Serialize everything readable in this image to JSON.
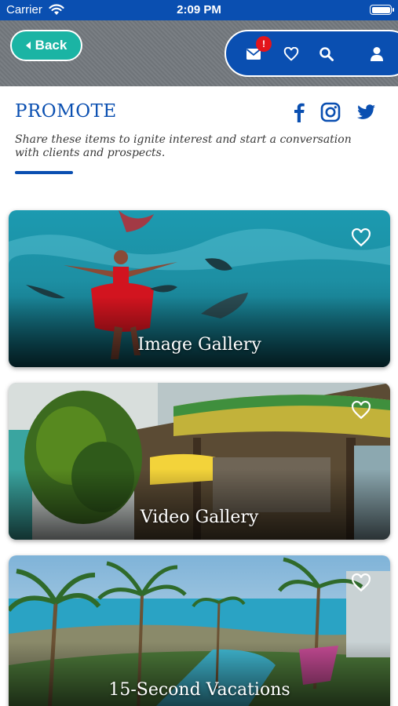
{
  "status_bar": {
    "carrier": "Carrier",
    "time": "2:09 PM"
  },
  "header": {
    "back_label": "Back",
    "mail_badge": "!",
    "icons": [
      "mail-icon",
      "heart-icon",
      "search-icon",
      "user-icon"
    ]
  },
  "promote": {
    "title": "PROMOTE",
    "description": "Share these items to ignite interest and start a conversation with clients and prospects.",
    "social_icons": [
      "facebook-icon",
      "instagram-icon",
      "twitter-icon"
    ]
  },
  "cards": [
    {
      "title": "Image Gallery",
      "icon": "heart-outline-icon"
    },
    {
      "title": "Video Gallery",
      "icon": "heart-outline-icon"
    },
    {
      "title": "15-Second Vacations",
      "icon": "heart-outline-icon"
    }
  ],
  "colors": {
    "brand_blue": "#0a4fb1",
    "teal": "#1bb4a4",
    "badge_red": "#e3141b"
  }
}
